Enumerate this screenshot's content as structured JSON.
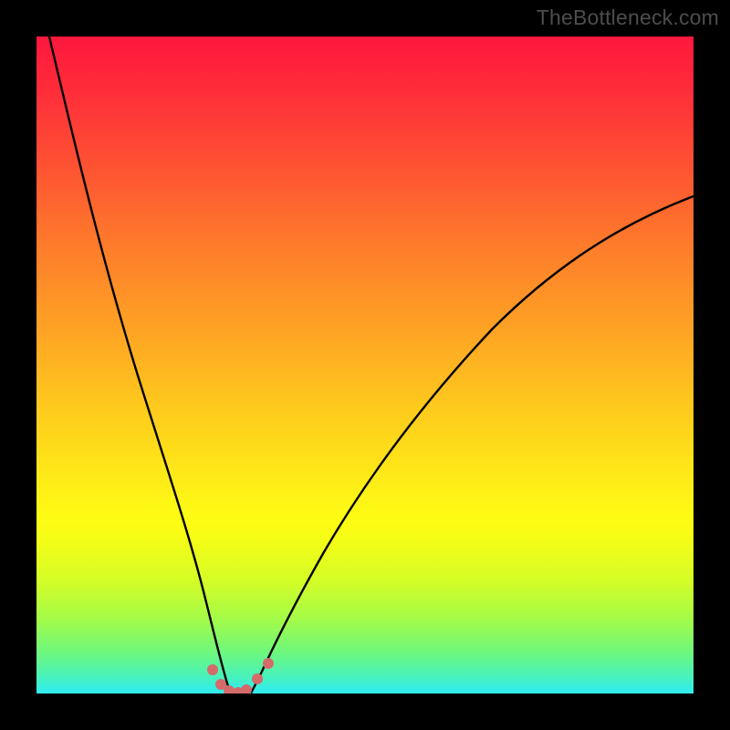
{
  "watermark": "TheBottleneck.com",
  "chart_data": {
    "type": "line",
    "title": "",
    "xlabel": "",
    "ylabel": "",
    "xlim": [
      0,
      100
    ],
    "ylim": [
      0,
      100
    ],
    "gradient_stops": [
      {
        "pos": 0,
        "color": "#fe173c"
      },
      {
        "pos": 20,
        "color": "#fe5332"
      },
      {
        "pos": 45,
        "color": "#fea424"
      },
      {
        "pos": 66,
        "color": "#fee718"
      },
      {
        "pos": 76,
        "color": "#f8fd15"
      },
      {
        "pos": 89,
        "color": "#a0fb4a"
      },
      {
        "pos": 97,
        "color": "#47f2bd"
      },
      {
        "pos": 100,
        "color": "#32edf2"
      }
    ],
    "series": [
      {
        "name": "left-curve",
        "x": [
          2,
          8,
          14,
          18,
          22,
          24.5,
          26.5,
          28,
          29,
          29.6
        ],
        "y": [
          100,
          76,
          52,
          36,
          20,
          11,
          5.5,
          2,
          0.6,
          0
        ]
      },
      {
        "name": "right-curve",
        "x": [
          32.6,
          33.5,
          35,
          38,
          43,
          50,
          60,
          72,
          86,
          100
        ],
        "y": [
          0,
          0.8,
          3,
          8,
          17,
          28,
          41,
          54,
          66,
          76
        ]
      }
    ],
    "bottom_dots": [
      {
        "x": 26.8,
        "y": 3.6
      },
      {
        "x": 28.1,
        "y": 1.4
      },
      {
        "x": 29.3,
        "y": 0.4
      },
      {
        "x": 30.7,
        "y": 0.1
      },
      {
        "x": 32.0,
        "y": 0.6
      },
      {
        "x": 33.6,
        "y": 2.2
      },
      {
        "x": 35.3,
        "y": 4.6
      }
    ],
    "annotations": []
  }
}
